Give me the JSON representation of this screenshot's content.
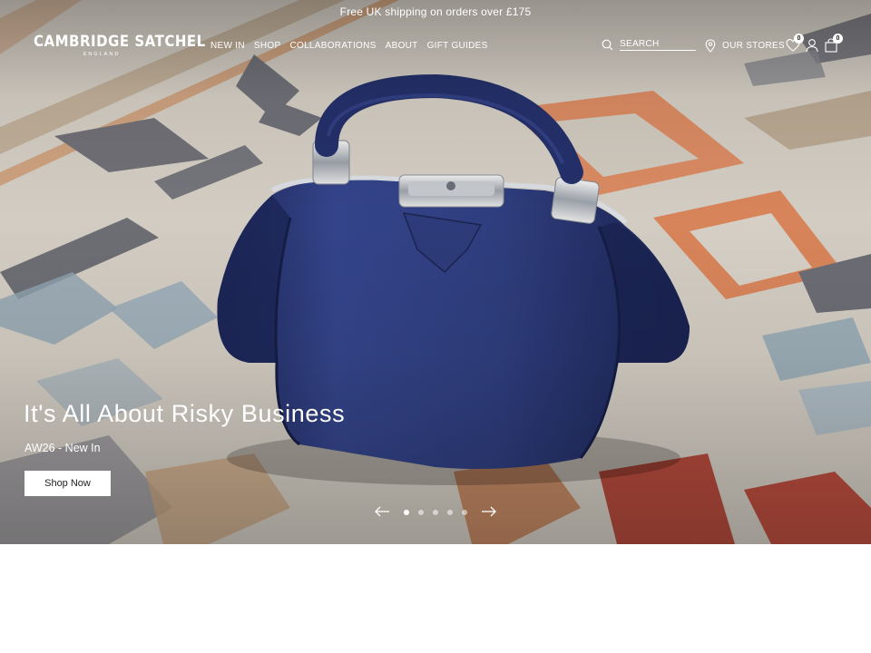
{
  "promo_bar": {
    "text": "Free UK shipping on orders over £175"
  },
  "logo": {
    "wordmark": "CAMBRIDGE SATCHEL",
    "subtext": "ENGLAND"
  },
  "nav": {
    "items": [
      {
        "label": "NEW IN"
      },
      {
        "label": "SHOP"
      },
      {
        "label": "COLLABORATIONS"
      },
      {
        "label": "ABOUT"
      },
      {
        "label": "GIFT GUIDES"
      }
    ]
  },
  "header_actions": {
    "search_placeholder": "SEARCH",
    "stores_label": "OUR STORES",
    "wishlist_count": "0",
    "cart_count": "0"
  },
  "hero": {
    "headline": "It's All About Risky Business",
    "subline": "AW26 - New In",
    "cta_label": "Shop Now",
    "slide_count": 5,
    "active_slide": 1
  },
  "colors": {
    "bag_navy": "#2c3a78",
    "rug_cream": "#d4cec4",
    "rug_orange": "#d98860",
    "rug_grey": "#7f7f86",
    "rug_blue": "#8fa4b2",
    "rug_red": "#b44a3c"
  },
  "icons": [
    "search-icon",
    "location-pin-icon",
    "heart-icon",
    "user-icon",
    "shopping-bag-icon",
    "arrow-left-icon",
    "arrow-right-icon"
  ]
}
